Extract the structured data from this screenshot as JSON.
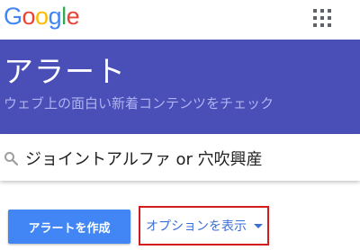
{
  "header": {
    "logo_letters": [
      "G",
      "o",
      "o",
      "g",
      "l",
      "e"
    ],
    "apps_icon": "grid-apps-icon"
  },
  "hero": {
    "title": "アラート",
    "subtitle": "ウェブ上の面白い新着コンテンツをチェック",
    "background_color": "#4a4fb8"
  },
  "search": {
    "icon": "search-icon",
    "value": "ジョイントアルファ or 穴吹興産"
  },
  "actions": {
    "create_label": "アラートを作成",
    "create_color": "#4285f4",
    "options_label": "オプションを表示",
    "options_icon": "caret-down-icon"
  }
}
